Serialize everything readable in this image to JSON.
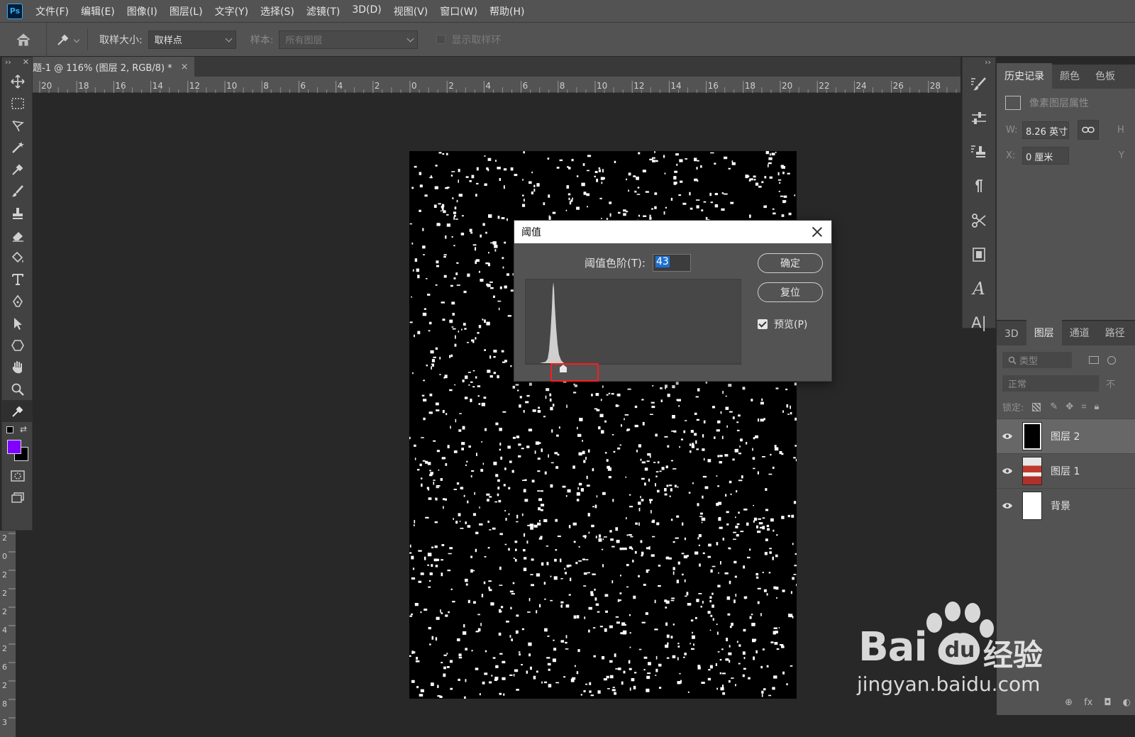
{
  "app": {
    "logo": "Ps"
  },
  "menu": [
    {
      "label": "文件(F)"
    },
    {
      "label": "编辑(E)"
    },
    {
      "label": "图像(I)"
    },
    {
      "label": "图层(L)"
    },
    {
      "label": "文字(Y)"
    },
    {
      "label": "选择(S)"
    },
    {
      "label": "滤镜(T)"
    },
    {
      "label": "3D(D)"
    },
    {
      "label": "视图(V)"
    },
    {
      "label": "窗口(W)"
    },
    {
      "label": "帮助(H)"
    }
  ],
  "options": {
    "sample_size_label": "取样大小:",
    "sample_size_value": "取样点",
    "sample_label": "样本:",
    "sample_value": "所有图层",
    "show_ring_label": "显示取样环"
  },
  "document_tab": {
    "title": "题-1 @ 116% (图层 2, RGB/8) *",
    "close": "×"
  },
  "ruler": {
    "top_ticks": [
      "20",
      "18",
      "16",
      "14",
      "12",
      "10",
      "8",
      "6",
      "4",
      "2",
      "0",
      "2",
      "4",
      "6",
      "8",
      "10",
      "12",
      "14",
      "16",
      "18",
      "20",
      "22",
      "24",
      "26",
      "28"
    ],
    "left_ticks": [
      "2",
      "0",
      "2",
      "2",
      "2",
      "4",
      "2",
      "6",
      "2",
      "8",
      "3"
    ]
  },
  "dialog": {
    "title": "阈值",
    "level_label": "阈值色阶(T):",
    "level_value": "43",
    "ok_label": "确定",
    "reset_label": "复位",
    "preview_label": "预览(P)",
    "preview_checked": true
  },
  "properties_panel": {
    "tabs": [
      {
        "label": "历史记录"
      },
      {
        "label": "颜色"
      },
      {
        "label": "色板"
      }
    ],
    "header": "像素图层属性",
    "w_label": "W:",
    "w_value": "8.26 英寸",
    "h_label": "H",
    "x_label": "X:",
    "x_value": "0 厘米",
    "y_label": "Y"
  },
  "layers_panel": {
    "tabs": [
      {
        "label": "3D"
      },
      {
        "label": "图层"
      },
      {
        "label": "通道"
      },
      {
        "label": "路径"
      }
    ],
    "filter_placeholder": "类型",
    "blend_mode": "正常",
    "opacity_label": "不",
    "lock_label": "锁定:",
    "layers": [
      {
        "name": "图层 2",
        "selected": true
      },
      {
        "name": "图层 1",
        "selected": false
      },
      {
        "name": "背景",
        "selected": false
      }
    ],
    "footer": [
      "⊕",
      "fx",
      "◘",
      "◐"
    ]
  },
  "colors": {
    "foreground": "#7f00ff",
    "background": "#000000"
  },
  "watermark": {
    "brand": "Bai",
    "brand2": "经验",
    "url": "jingyan.baidu.com"
  }
}
